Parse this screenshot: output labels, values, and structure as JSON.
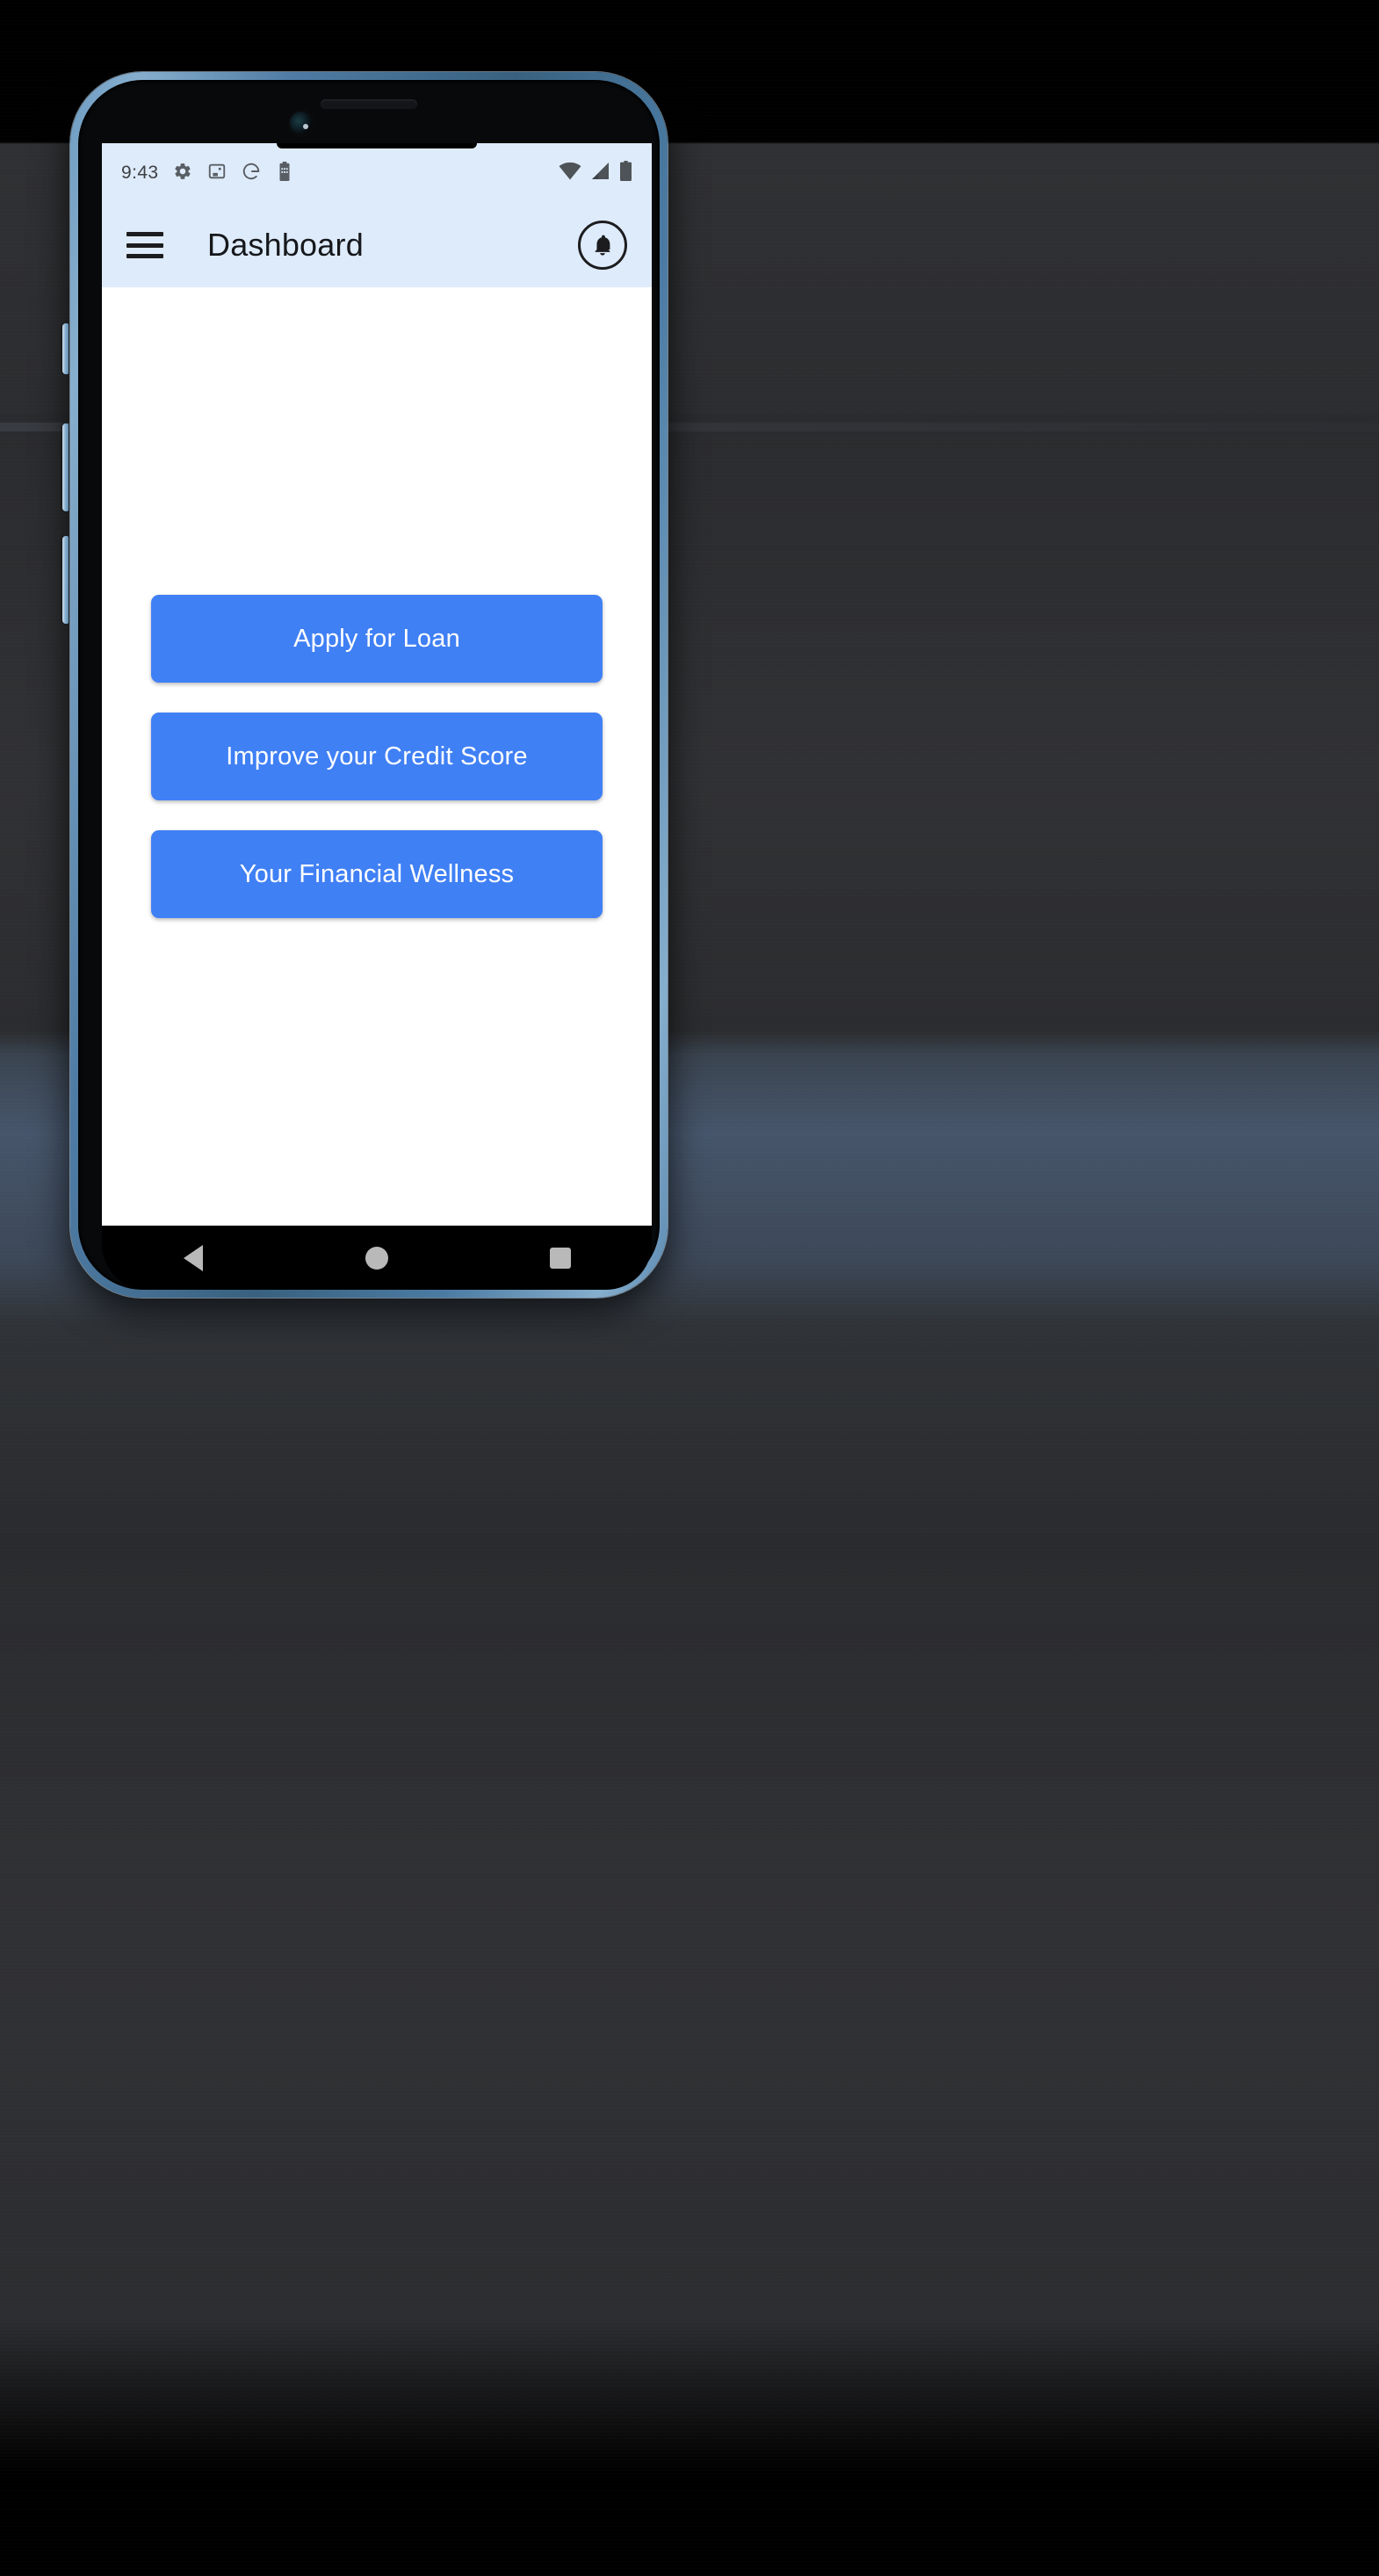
{
  "device": {
    "frame_color": "#5b87b0",
    "screen_bg": "#ffffff"
  },
  "status_bar": {
    "time": "9:43",
    "background": "#deebfb",
    "left_icons": [
      "settings-gear-icon",
      "screenshot-icon",
      "google-g-icon",
      "battery-saver-icon"
    ],
    "right_icons": [
      "wifi-icon",
      "cellular-signal-icon",
      "battery-icon"
    ]
  },
  "app_bar": {
    "menu_icon": "hamburger-menu-icon",
    "title": "Dashboard",
    "action_icon": "notification-bell-icon",
    "background": "#deebfb",
    "title_color": "#16181b"
  },
  "main": {
    "background": "#ffffff",
    "accent_color": "#4080f5",
    "buttons": [
      {
        "label": "Apply for Loan",
        "name": "apply-for-loan-button"
      },
      {
        "label": "Improve your Credit Score",
        "name": "improve-credit-score-button"
      },
      {
        "label": "Your Financial Wellness",
        "name": "financial-wellness-button"
      }
    ]
  },
  "nav_bar": {
    "background": "#000000",
    "icon_color": "#b9b9b9",
    "items": [
      {
        "name": "nav-back-button",
        "icon": "triangle-back-icon"
      },
      {
        "name": "nav-home-button",
        "icon": "circle-home-icon"
      },
      {
        "name": "nav-recents-button",
        "icon": "square-recents-icon"
      }
    ]
  }
}
